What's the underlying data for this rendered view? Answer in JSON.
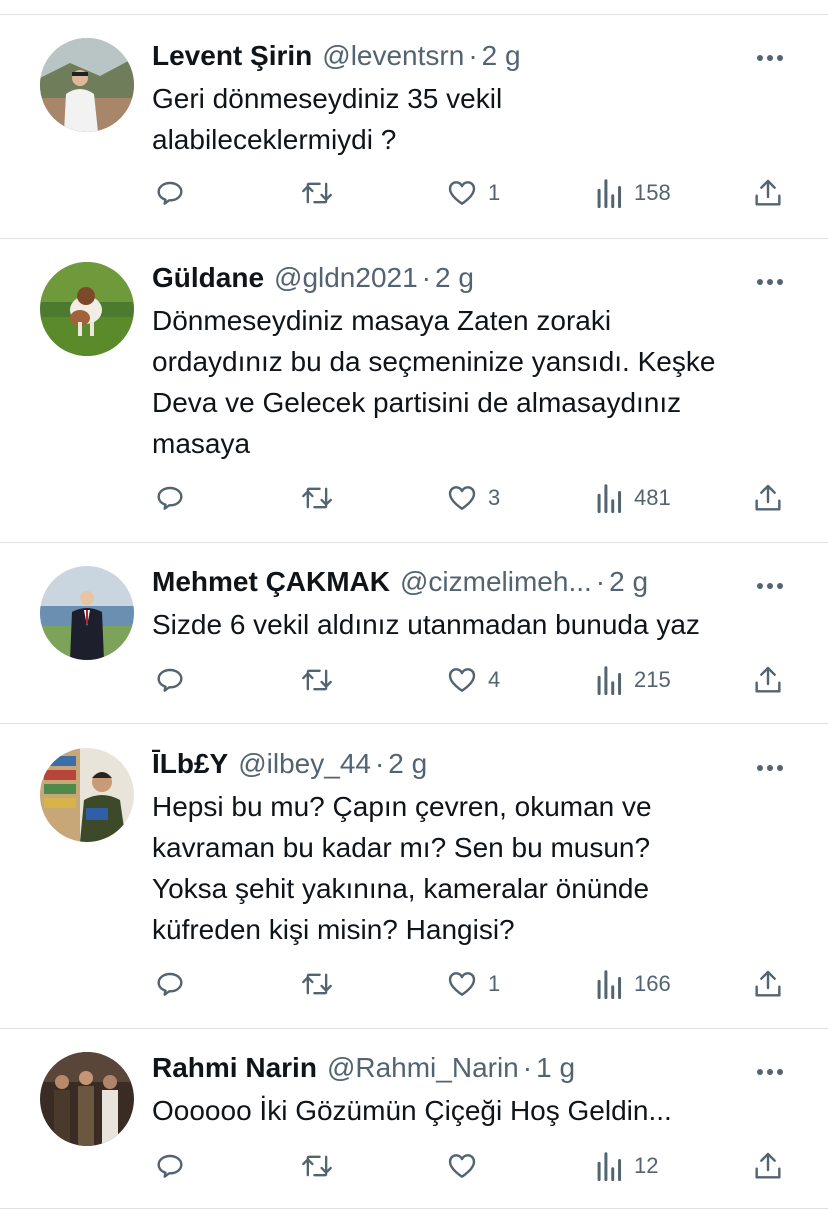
{
  "tweets": [
    {
      "name": "Levent Şirin",
      "handle": "@leventsrn",
      "sep": "·",
      "time": "2 g",
      "lines": [
        "Geri dönmeseydiniz 35 vekil",
        "alabileceklermiydi ?"
      ],
      "likes": "1",
      "views": "158"
    },
    {
      "name": "Güldane",
      "handle": "@gldn2021",
      "sep": "·",
      "time": "2 g",
      "lines": [
        "Dönmeseydiniz masaya Zaten zoraki",
        "ordaydınız bu da seçmeninize yansıdı. Keşke",
        "Deva ve Gelecek partisini de almasaydınız",
        "masaya"
      ],
      "likes": "3",
      "views": "481"
    },
    {
      "name": "Mehmet ÇAKMAK",
      "handle": "@cizmelimeh...",
      "sep": "·",
      "time": "2 g",
      "lines": [
        "Sizde 6 vekil aldınız utanmadan bunuda yaz"
      ],
      "likes": "4",
      "views": "215"
    },
    {
      "name": "ĪLb£Y",
      "handle": "@ilbey_44",
      "sep": "·",
      "time": "2 g",
      "lines": [
        "Hepsi bu mu? Çapın çevren, okuman ve",
        "kavraman bu kadar mı? Sen bu musun?",
        "Yoksa şehit yakınına, kameralar önünde",
        "küfreden kişi misin? Hangisi?"
      ],
      "likes": "1",
      "views": "166"
    },
    {
      "name": "Rahmi Narin",
      "handle": "@Rahmi_Narin",
      "sep": "·",
      "time": "1 g",
      "lines": [
        "Oooooo İki Gözümün Çiçeği Hoş Geldin..."
      ],
      "likes": "",
      "views": "12"
    }
  ],
  "icons": {
    "reply": "reply-icon",
    "retweet": "retweet-icon",
    "like": "heart-icon",
    "views": "views-icon",
    "share": "share-icon",
    "more": "more-icon"
  },
  "colors": {
    "text": "#0f1419",
    "secondary": "#536471",
    "divider": "#dfe3e6"
  }
}
